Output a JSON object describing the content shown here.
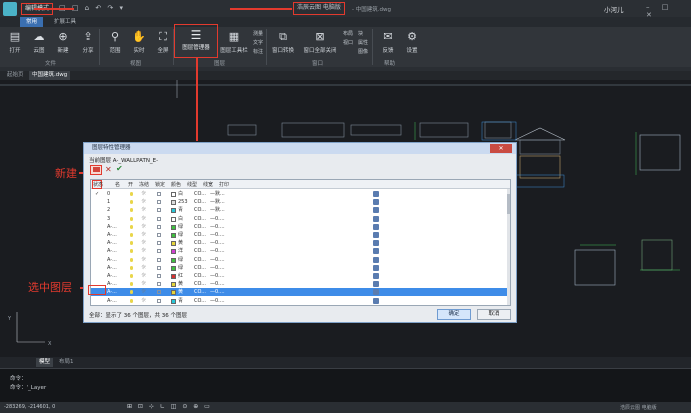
{
  "titlebar": {
    "workspace": "编辑模式",
    "qa_icons": "□ □ ⌂ ↶ ↷ ▾",
    "title": "浩辰云图 电脑版",
    "file": "- 中国建筑.dwg",
    "user": "小河儿",
    "win_controls": "– □ ✕"
  },
  "ribbon": {
    "tabs": [
      "常用",
      "扩展工具"
    ],
    "buttons": [
      {
        "label": "打开",
        "icon": "folder-icon"
      },
      {
        "label": "云图",
        "icon": "cloud-icon"
      },
      {
        "label": "新建",
        "icon": "new-file-icon"
      },
      {
        "label": "分享",
        "icon": "share-icon"
      },
      {
        "label": "范围",
        "icon": "zoom-icon"
      },
      {
        "label": "实时",
        "icon": "pan-icon"
      },
      {
        "label": "全屏",
        "icon": "fullscreen-icon"
      },
      {
        "label": "图层管理器",
        "icon": "layers-icon"
      },
      {
        "label": "图层工具栏",
        "icon": "layer-toolbar-icon"
      },
      {
        "label": "窗口转换",
        "icon": "window-switch-icon"
      },
      {
        "label": "窗口全部关闭",
        "icon": "close-all-icon"
      },
      {
        "label": "反馈",
        "icon": "feedback-icon"
      },
      {
        "label": "设置",
        "icon": "settings-icon"
      }
    ],
    "small_items": [
      "测量",
      "文字",
      "标注",
      "布局",
      "视口",
      "块",
      "属性",
      "图像"
    ],
    "groups": [
      "文件",
      "视图",
      "图层",
      "窗口",
      "帮助"
    ]
  },
  "doc_tabs": [
    "起始页",
    "中国建筑.dwg"
  ],
  "dialog": {
    "title": "图层特性管理器",
    "close": "✕",
    "current_layer": "当前图层   A-_WALLPATN_E-",
    "columns": [
      "状态",
      "名",
      "开",
      "冻结",
      "锁定",
      "颜色",
      "线型",
      "线宽",
      "打印"
    ],
    "rows": [
      {
        "status": "✓",
        "name": "0",
        "color_name": "白",
        "color_hex": "#ffffff",
        "linetype": "CO...",
        "lineweight": "—默..."
      },
      {
        "status": "",
        "name": "1",
        "color_name": "253",
        "color_hex": "#dcdcdc",
        "linetype": "CO...",
        "lineweight": "—默..."
      },
      {
        "status": "",
        "name": "2",
        "color_name": "青",
        "color_hex": "#27c6d8",
        "linetype": "CO...",
        "lineweight": "—默..."
      },
      {
        "status": "",
        "name": "3",
        "color_name": "白",
        "color_hex": "#ffffff",
        "linetype": "CO...",
        "lineweight": "—0...."
      },
      {
        "status": "",
        "name": "A-...",
        "color_name": "绿",
        "color_hex": "#3fbf3f",
        "linetype": "CO...",
        "lineweight": "—0...."
      },
      {
        "status": "",
        "name": "A-...",
        "color_name": "绿",
        "color_hex": "#3fbf3f",
        "linetype": "CO...",
        "lineweight": "—0...."
      },
      {
        "status": "",
        "name": "A-...",
        "color_name": "黄",
        "color_hex": "#e5d43a",
        "linetype": "CO...",
        "lineweight": "—0...."
      },
      {
        "status": "",
        "name": "A-...",
        "color_name": "洋",
        "color_hex": "#d03fd0",
        "linetype": "CO...",
        "lineweight": "—0...."
      },
      {
        "status": "",
        "name": "A-...",
        "color_name": "绿",
        "color_hex": "#3fbf3f",
        "linetype": "CO...",
        "lineweight": "—0...."
      },
      {
        "status": "",
        "name": "A-...",
        "color_name": "绿",
        "color_hex": "#3fbf3f",
        "linetype": "CO...",
        "lineweight": "—0...."
      },
      {
        "status": "",
        "name": "A-...",
        "color_name": "红",
        "color_hex": "#d83030",
        "linetype": "CO...",
        "lineweight": "—0...."
      },
      {
        "status": "",
        "name": "A-...",
        "color_name": "黄",
        "color_hex": "#e5d43a",
        "linetype": "CO...",
        "lineweight": "—0...."
      },
      {
        "status": "",
        "name": "A-...",
        "color_name": "黄",
        "color_hex": "#e5d43a",
        "linetype": "CO...",
        "lineweight": "—0...."
      },
      {
        "status": "",
        "name": "A-...",
        "color_name": "青",
        "color_hex": "#27c6d8",
        "linetype": "CO...",
        "lineweight": "—0...."
      }
    ],
    "selected_row": 12,
    "footer": "全部：显示了 36 个图层，共 36 个图层",
    "ok": "确定",
    "cancel": "取消"
  },
  "annotations": {
    "new": "新建",
    "select": "选中图层"
  },
  "layout_tabs": [
    "模型",
    "布局1"
  ],
  "command": {
    "line1": "命令：",
    "line2": "命令：'_Layer"
  },
  "status": {
    "coords": "-283269, -214601, 0",
    "icons": "⊞ ⊡ ⊹ ∟ ◫ ⊙ ⊕ ▭",
    "brand": "浩辰云图 电脑版"
  },
  "colors": {
    "accent": "#3a6fb1",
    "highlight_red": "#e23a2e",
    "selection": "#3e8ce8"
  }
}
